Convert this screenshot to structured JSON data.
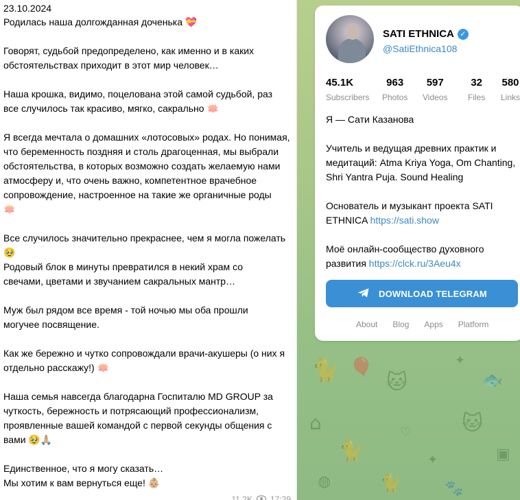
{
  "post": {
    "date": "23.10.2024",
    "paragraphs": [
      [
        "Родилась наша долгожданная доченька 💝"
      ],
      [
        "Говорят, судьбой предопределено, как именно и в каких",
        "обстоятельствах приходит в этот мир человек…"
      ],
      [
        "Наша крошка, видимо, поцелована этой самой судьбой, раз",
        "все случилось так красиво, мягко, сакрально 🪷"
      ],
      [
        "Я всегда мечтала о домашних «лотосовых» родах. Но понимая,",
        "что беременность поздняя и столь драгоценная, мы выбрали",
        "обстоятельства, в которых возможно создать желаемую нами",
        "атмосферу и, что очень важно, компетентное врачебное",
        "сопровождение, настроенное на такие же органичные роды",
        "🪷"
      ],
      [
        "Все случилось значительно прекраснее, чем я могла пожелать",
        "🥹",
        "Родовый блок в минуты превратился в некий храм со",
        "свечами, цветами и звучанием сакральных мантр…"
      ],
      [
        "Муж был рядом все время - той ночью мы оба прошли",
        "могучее посвящение."
      ],
      [
        "Как же бережно и чутко сопровождали врачи-акушеры (о них я",
        "отдельно расскажу!) 🪷"
      ],
      [
        "Наша семья навсегда благодарна Госпиталю MD GROUP за",
        "чуткость, бережность и потрясающий профессионализм,",
        "проявленные вашей командой с первой секунды общения с",
        "вами 🥹🙏🏼"
      ],
      [
        "Единственное, что я могу сказать…",
        "Мы хотим к вам вернуться еще! 👶🏼"
      ]
    ],
    "views": "11.2K",
    "time": "17:29"
  },
  "profile": {
    "name": "SATI ETHNICA",
    "handle": "@SatiEthnica108",
    "stats": [
      {
        "value": "45.1K",
        "label": "Subscribers"
      },
      {
        "value": "963",
        "label": "Photos"
      },
      {
        "value": "597",
        "label": "Videos"
      },
      {
        "value": "32",
        "label": "Files"
      },
      {
        "value": "580",
        "label": "Links"
      }
    ],
    "bio": {
      "line1": "Я — Сати Казанова",
      "line2": "Учитель и ведущая древних практик и медитаций: Atma Kriya Yoga, Om Chanting, Shri Yantra Puja. Sound Healing",
      "line3_text": "Основатель и музыкант проекта SATI ETHNICA ",
      "line3_link": "https://sati.show",
      "line4_text": "Моё онлайн-сообщество духовного развития ",
      "line4_link": "https://clck.ru/3Aeu4x"
    },
    "download_label": "DOWNLOAD TELEGRAM",
    "footer": [
      "About",
      "Blog",
      "Apps",
      "Platform"
    ]
  },
  "colors": {
    "accent": "#3a8fd5",
    "link": "#3b88c4",
    "verified": "#3a97e5",
    "background": "#a9c788"
  },
  "icons": {
    "verified": "check-badge-icon",
    "download": "telegram-plane-icon",
    "views": "eye-icon"
  }
}
